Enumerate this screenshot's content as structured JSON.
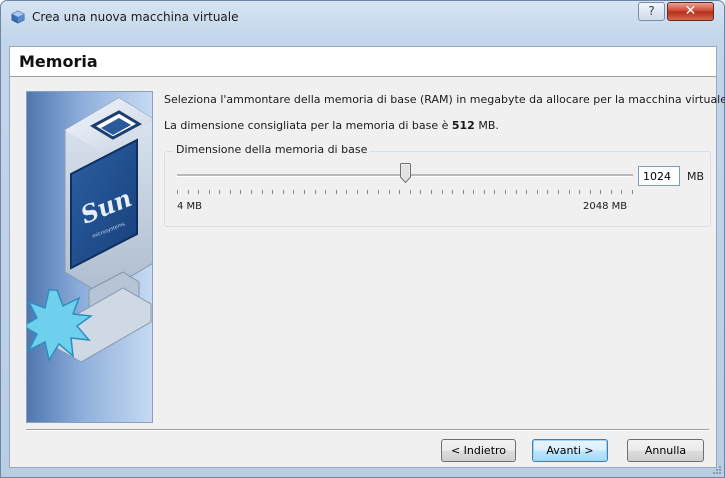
{
  "window": {
    "title": "Crea una nuova macchina virtuale",
    "help_label": "?",
    "close_label": "✕"
  },
  "page": {
    "heading": "Memoria"
  },
  "content": {
    "description": "Seleziona l'ammontare della memoria di base (RAM) in megabyte da allocare per la macchina virtuale.",
    "recommended_prefix": "La dimensione consigliata per la memoria di base è ",
    "recommended_value": "512",
    "recommended_suffix": " MB."
  },
  "memory": {
    "group_label": "Dimensione della memoria di base",
    "value": "1024",
    "unit": "MB",
    "min_label": "4 MB",
    "max_label": "2048 MB",
    "min": 4,
    "max": 2048,
    "current": 1024
  },
  "buttons": {
    "back": "< Indietro",
    "next": "Avanti >",
    "cancel": "Annulla"
  },
  "image": {
    "brand_text": "Sun",
    "brand_subtext": "microsystems"
  },
  "colors": {
    "title_bar": "#c3d5ea",
    "close_button": "#c9422c",
    "default_button_border": "#3c7fb1"
  }
}
